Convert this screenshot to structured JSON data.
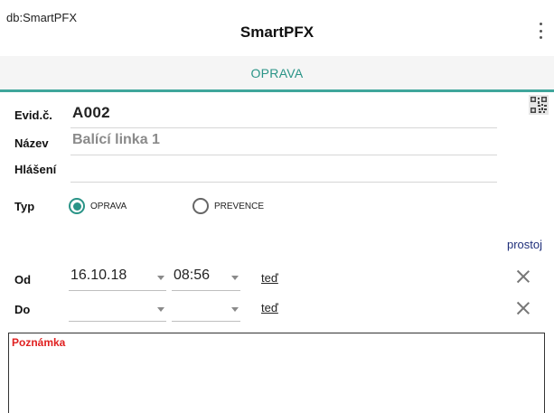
{
  "app_bar": {
    "db_label": "db:SmartPFX",
    "title": "SmartPFX",
    "menu_icon": "more-vert-icon"
  },
  "tab": {
    "label": "OPRAVA",
    "accent_color": "#2a9487"
  },
  "form": {
    "evid": {
      "label": "Evid.č.",
      "value": "A002"
    },
    "nazev": {
      "label": "Název",
      "value": "Balící linka 1"
    },
    "hlaseni": {
      "label": "Hlášení",
      "value": ""
    },
    "typ": {
      "label": "Typ",
      "options": [
        {
          "label": "OPRAVA",
          "selected": true
        },
        {
          "label": "PREVENCE",
          "selected": false
        }
      ]
    },
    "prostoj_link": "prostoj",
    "od": {
      "label": "Od",
      "date": "16.10.18",
      "time": "08:56",
      "now_link": "teď"
    },
    "do": {
      "label": "Do",
      "date": "",
      "time": "",
      "now_link": "teď"
    },
    "poznamka": {
      "label": "Poznámka",
      "value": "",
      "label_color": "#e02020"
    }
  },
  "icons": {
    "qr": "qr-code-icon",
    "clear": "close-icon",
    "dropdown": "dropdown-arrow-icon",
    "radio": "radio-icon"
  }
}
